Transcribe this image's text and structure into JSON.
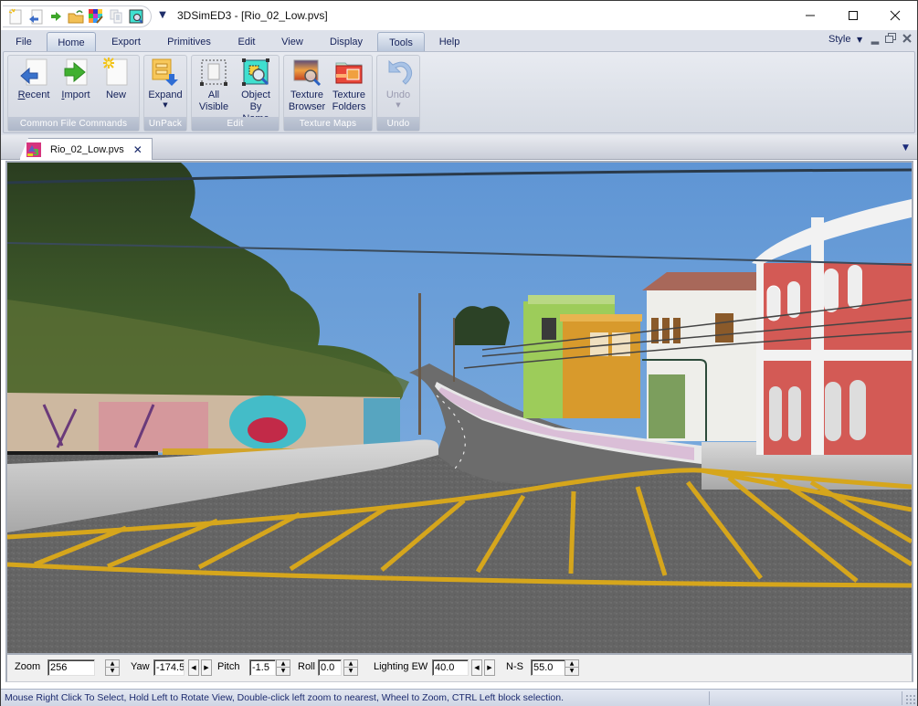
{
  "window": {
    "title": "3DSimED3 - [Rio_02_Low.pvs]",
    "controls": {
      "minimize": "minimize",
      "maximize": "maximize",
      "close": "close"
    }
  },
  "quick_access": [
    {
      "name": "new-icon"
    },
    {
      "name": "recent-icon"
    },
    {
      "name": "import-icon"
    },
    {
      "name": "open-folder-icon"
    },
    {
      "name": "palette-icon"
    },
    {
      "name": "copy-icon"
    },
    {
      "name": "object-by-name-icon"
    }
  ],
  "ribbon": {
    "tabs": [
      {
        "label": "File"
      },
      {
        "label": "Home",
        "active": true
      },
      {
        "label": "Export"
      },
      {
        "label": "Primitives"
      },
      {
        "label": "Edit"
      },
      {
        "label": "View"
      },
      {
        "label": "Display"
      },
      {
        "label": "Tools",
        "highlighted": true
      },
      {
        "label": "Help"
      }
    ],
    "style_menu": "Style",
    "groups": [
      {
        "label": "Common File Commands",
        "buttons": [
          {
            "label": "Recent",
            "mnemonic": "R",
            "rest": "ecent",
            "icon": "recent-icon"
          },
          {
            "label": "Import",
            "mnemonic": "I",
            "rest": "mport",
            "icon": "import-icon"
          },
          {
            "label": "New",
            "icon": "new-icon"
          }
        ]
      },
      {
        "label": "UnPack",
        "buttons": [
          {
            "label": "Expand",
            "icon": "expand-icon",
            "dropdown": true
          }
        ]
      },
      {
        "label": "Edit",
        "buttons": [
          {
            "label_line1": "All",
            "label_line2": "Visible",
            "icon": "all-visible-icon"
          },
          {
            "label_line1": "Object",
            "label_line2": "By Name",
            "icon": "object-by-name-icon"
          }
        ]
      },
      {
        "label": "Texture Maps",
        "buttons": [
          {
            "label_line1": "Texture",
            "label_line2": "Browser",
            "icon": "texture-browser-icon"
          },
          {
            "label_line1": "Texture",
            "label_line2": "Folders",
            "icon": "texture-folders-icon"
          }
        ]
      },
      {
        "label": "Undo",
        "buttons": [
          {
            "label": "Undo",
            "icon": "undo-icon",
            "dropdown": true,
            "disabled": true
          }
        ]
      }
    ]
  },
  "document_tab": {
    "title": "Rio_02_Low.pvs"
  },
  "viewport": {
    "scene": "3D track view: Rio street circuit with graffiti wall, colonial buildings, overhead cables and yellow hatched run-off area"
  },
  "controls": {
    "zoom": {
      "label": "Zoom",
      "value": "256"
    },
    "yaw": {
      "label": "Yaw",
      "value": "-174.5"
    },
    "pitch": {
      "label": "Pitch",
      "value": "-1.5"
    },
    "roll": {
      "label": "Roll",
      "value": "0.0"
    },
    "lighting_ew": {
      "label": "Lighting EW",
      "value": "40.0"
    },
    "ns": {
      "label": "N-S",
      "value": "55.0"
    }
  },
  "status_bar": {
    "text": "Mouse Right Click To Select, Hold Left to Rotate View, Double-click left  zoom to nearest, Wheel to Zoom, CTRL Left block selection."
  },
  "colors": {
    "ribbon_bg": "#dde1ea",
    "tab_text": "#15225a",
    "sky": "#6a9fd8",
    "building_red": "#d35a55",
    "building_green": "#9dcc5a",
    "building_orange": "#d89a2c",
    "road": "#6c6c6c",
    "hatch_yellow": "#d6a61c"
  }
}
